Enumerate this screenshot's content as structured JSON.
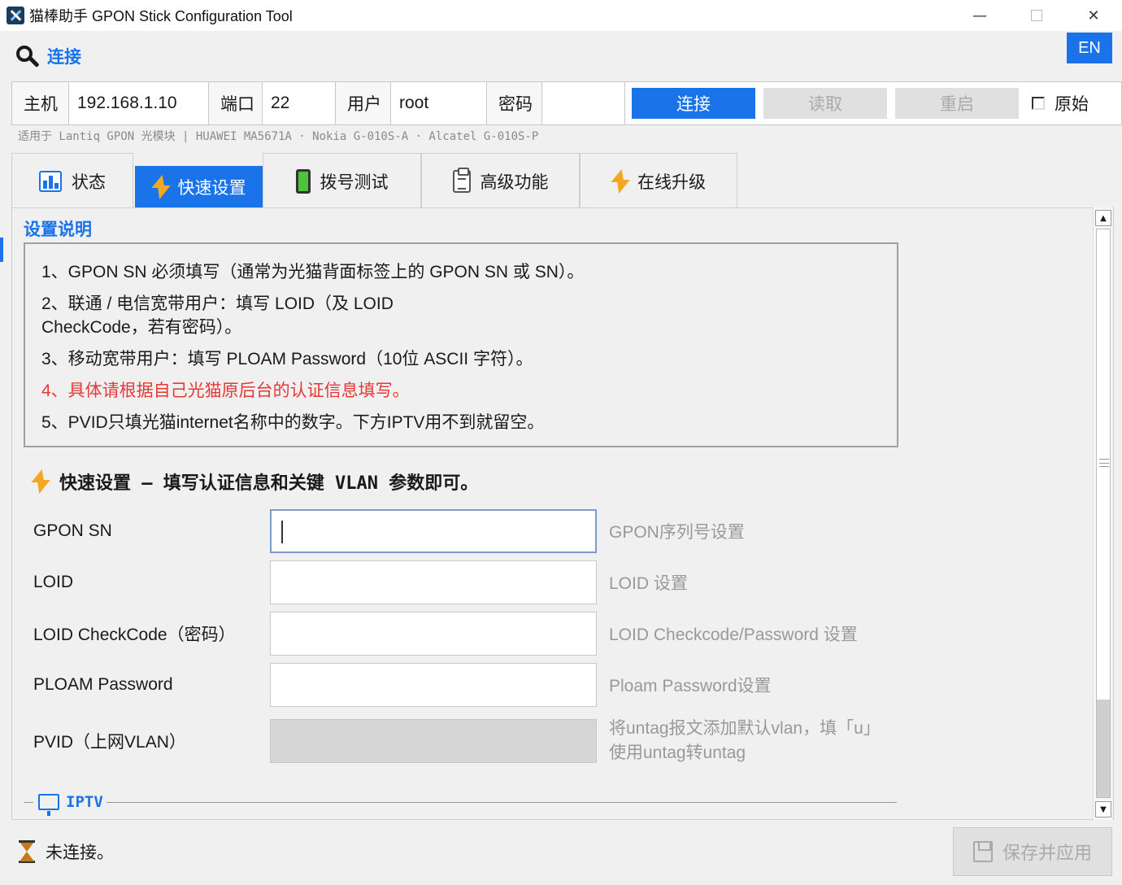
{
  "window": {
    "title": "猫棒助手  GPON Stick Configuration Tool",
    "minimize": "—",
    "close": "✕"
  },
  "header": {
    "connect_title": "连接",
    "lang": "EN"
  },
  "connection": {
    "host_label": "主机",
    "host_value": "192.168.1.10",
    "port_label": "端口",
    "port_value": "22",
    "user_label": "用户",
    "user_value": "root",
    "password_label": "密码",
    "password_value": "",
    "connect_btn": "连接",
    "read_btn": "读取",
    "reboot_btn": "重启",
    "raw_label": "原始",
    "raw_checked": false
  },
  "compat_text": "适用于 Lantiq GPON 光模块  |  HUAWEI MA5671A · Nokia G-010S-A · Alcatel G-010S-P",
  "tabs": [
    {
      "label": "状态",
      "icon": "chart-icon",
      "active": false
    },
    {
      "label": "快速设置",
      "icon": "bolt-icon",
      "active": true
    },
    {
      "label": "拨号测试",
      "icon": "phone-icon",
      "active": false
    },
    {
      "label": "高级功能",
      "icon": "clipboard-icon",
      "active": false
    },
    {
      "label": "在线升级",
      "icon": "bolt-icon",
      "active": false
    }
  ],
  "instructions": {
    "title": "设置说明",
    "items": [
      "1、GPON SN 必须填写（通常为光猫背面标签上的 GPON SN 或 SN）。",
      "2、联通 / 电信宽带用户：填写 LOID（及 LOID CheckCode，若有密码）。",
      "3、移动宽带用户：填写 PLOAM Password（10位 ASCII 字符）。",
      "4、具体请根据自己光猫原后台的认证信息填写。",
      "5、PVID只填光猫internet名称中的数字。下方IPTV用不到就留空。"
    ]
  },
  "quick": {
    "header": "快速设置 — 填写认证信息和关键 VLAN 参数即可。",
    "fields": [
      {
        "label": "GPON SN",
        "value": "",
        "hint": "GPON序列号设置"
      },
      {
        "label": "LOID",
        "value": "",
        "hint": "LOID 设置"
      },
      {
        "label": "LOID CheckCode（密码）",
        "value": "",
        "hint": "LOID Checkcode/Password 设置"
      },
      {
        "label": "PLOAM Password",
        "value": "",
        "hint": "Ploam Password设置"
      },
      {
        "label": "PVID（上网VLAN）",
        "value": "",
        "hint": "将untag报文添加默认vlan，填「u」使用untag转untag"
      }
    ],
    "iptv_label": "IPTV"
  },
  "status": {
    "text": "未连接。",
    "save_btn": "保存并应用"
  },
  "colors": {
    "accent": "#1a73e8",
    "warning": "#e53935",
    "disabled": "#aaaaaa"
  }
}
